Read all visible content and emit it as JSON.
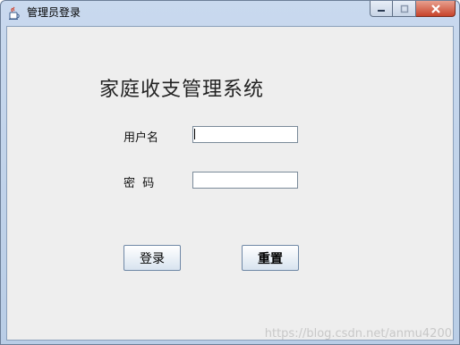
{
  "window": {
    "title": "管理员登录",
    "app_icon": "java-cup-icon",
    "controls": [
      "minimize-icon",
      "maximize-icon",
      "close-icon"
    ]
  },
  "form": {
    "heading": "家庭收支管理系统",
    "username_label": "用户名",
    "username_value": "",
    "password_label": "密  码",
    "password_value": ""
  },
  "buttons": {
    "login_label": "登录",
    "reset_label": "重置"
  },
  "watermark": "https://blog.csdn.net/anmu4200",
  "colors": {
    "client_background": "#eeeeee",
    "close_button": "#c7432a",
    "titlebar": "#c9d9ee"
  }
}
